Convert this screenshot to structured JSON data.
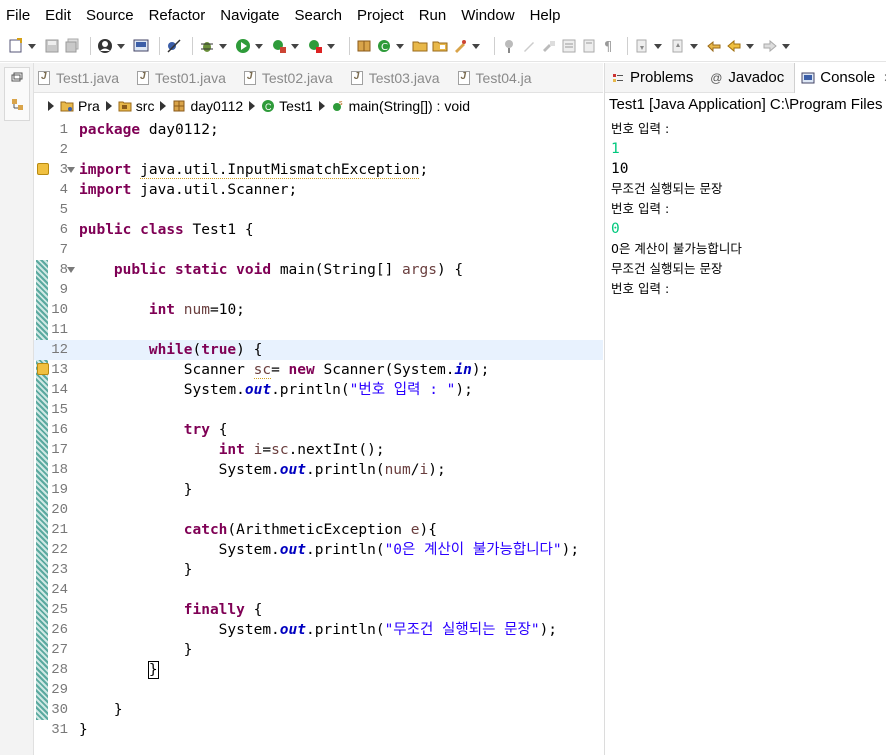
{
  "menu": [
    "File",
    "Edit",
    "Source",
    "Refactor",
    "Navigate",
    "Search",
    "Project",
    "Run",
    "Window",
    "Help"
  ],
  "editor_tabs": [
    "Test1.java",
    "Test01.java",
    "Test02.java",
    "Test03.java",
    "Test04.ja"
  ],
  "breadcrumb": {
    "project": "Pra",
    "folder": "src",
    "package": "day0112",
    "class": "Test1",
    "method": "main(String[]) : void"
  },
  "code_lines": [
    {
      "n": "1",
      "html": "<span class=\"kw\">package</span> day0112;"
    },
    {
      "n": "2",
      "html": ""
    },
    {
      "n": "3",
      "html": "<span class=\"kw\">import</span> <span class=\"squiggle\">java.util.InputMismatchException</span>;",
      "warn": true,
      "fold": true
    },
    {
      "n": "4",
      "html": "<span class=\"kw\">import</span> java.util.Scanner;"
    },
    {
      "n": "5",
      "html": ""
    },
    {
      "n": "6",
      "html": "<span class=\"kw\">public</span> <span class=\"kw\">class</span> Test1 {"
    },
    {
      "n": "7",
      "html": ""
    },
    {
      "n": "8",
      "html": "    <span class=\"kw\">public</span> <span class=\"kw\">static</span> <span class=\"kw\">void</span> main(String[] <span class=\"var\">args</span>) {",
      "fold": true
    },
    {
      "n": "9",
      "html": ""
    },
    {
      "n": "10",
      "html": "        <span class=\"kw\">int</span> <span class=\"var\">num</span>=10;"
    },
    {
      "n": "11",
      "html": ""
    },
    {
      "n": "12",
      "html": "        <span class=\"kw\">while</span>(<span class=\"kw\">true</span>) {",
      "hl": true
    },
    {
      "n": "13",
      "html": "            Scanner <span class=\"var squiggle\">sc</span>= <span class=\"kw\">new</span> Scanner(System.<span class=\"field\">in</span>);",
      "warn": true
    },
    {
      "n": "14",
      "html": "            System.<span class=\"field\">out</span>.println(<span class=\"str\">\"번호 입력 : \"</span>);"
    },
    {
      "n": "15",
      "html": ""
    },
    {
      "n": "16",
      "html": "            <span class=\"kw\">try</span> {"
    },
    {
      "n": "17",
      "html": "                <span class=\"kw\">int</span> <span class=\"var\">i</span>=<span class=\"var\">sc</span>.nextInt();"
    },
    {
      "n": "18",
      "html": "                System.<span class=\"field\">out</span>.println(<span class=\"var\">num</span>/<span class=\"var\">i</span>);"
    },
    {
      "n": "19",
      "html": "            }"
    },
    {
      "n": "20",
      "html": ""
    },
    {
      "n": "21",
      "html": "            <span class=\"kw\">catch</span>(ArithmeticException <span class=\"var\">e</span>){"
    },
    {
      "n": "22",
      "html": "                System.<span class=\"field\">out</span>.println(<span class=\"str\">\"0은 계산이 불가능합니다\"</span>);"
    },
    {
      "n": "23",
      "html": "            }"
    },
    {
      "n": "24",
      "html": ""
    },
    {
      "n": "25",
      "html": "            <span class=\"kw\">finally</span> {"
    },
    {
      "n": "26",
      "html": "                System.<span class=\"field\">out</span>.println(<span class=\"str\">\"무조건 실행되는 문장\"</span>);"
    },
    {
      "n": "27",
      "html": "            }"
    },
    {
      "n": "28",
      "html": "        <span class=\"caret-box\">}</span>"
    },
    {
      "n": "29",
      "html": ""
    },
    {
      "n": "30",
      "html": "    }"
    },
    {
      "n": "31",
      "html": "}"
    }
  ],
  "right_tabs": {
    "problems": "Problems",
    "javadoc": "Javadoc",
    "console": "Console"
  },
  "console": {
    "title": "Test1 [Java Application] C:\\Program Files",
    "lines": [
      {
        "text": "번호 입력 :",
        "kind": "text"
      },
      {
        "text": "1",
        "kind": "input"
      },
      {
        "text": "10",
        "kind": "num"
      },
      {
        "text": "무조건 실행되는 문장",
        "kind": "text"
      },
      {
        "text": "번호 입력 :",
        "kind": "text"
      },
      {
        "text": "0",
        "kind": "input"
      },
      {
        "text": "0은 계산이 불가능합니다",
        "kind": "text"
      },
      {
        "text": "무조건 실행되는 문장",
        "kind": "text"
      },
      {
        "text": "번호 입력 :",
        "kind": "text"
      }
    ]
  },
  "colors": {
    "keyword": "#7f0055",
    "string": "#2a00ff",
    "field": "#0000c0",
    "console_input": "#00c87d",
    "current_line": "#e8f2fe"
  }
}
